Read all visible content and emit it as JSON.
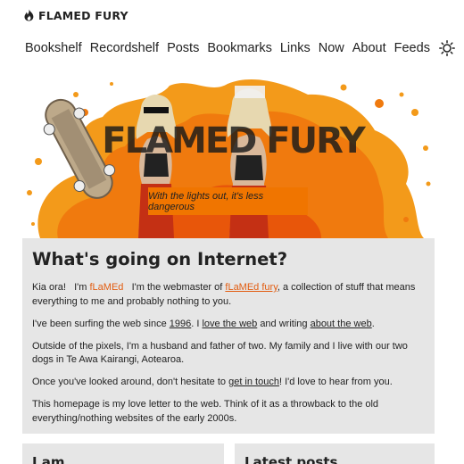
{
  "site": {
    "title": "FLAMED FURY",
    "logo_icon": "flame-icon"
  },
  "nav": {
    "items": [
      {
        "label": "Bookshelf"
      },
      {
        "label": "Recordshelf"
      },
      {
        "label": "Posts"
      },
      {
        "label": "Bookmarks"
      },
      {
        "label": "Links"
      },
      {
        "label": "Now"
      },
      {
        "label": "About"
      },
      {
        "label": "Feeds"
      }
    ],
    "theme_icon": "sun-icon"
  },
  "hero": {
    "banner_text": "FLAMED FURY",
    "tagline": "With the lights out, it's less dangerous"
  },
  "intro": {
    "title": "What's going on Internet?",
    "p1": {
      "greeting": "Kia ora!",
      "im": "I'm",
      "name": "fLaMEd",
      "middle": "I'm the webmaster of",
      "site_link": "fLaMEd fury",
      "end": ", a collection of stuff that means everything to me and probably nothing to you."
    },
    "p2": {
      "start": "I've been surfing the web since",
      "year_link": "1996",
      "mid1": ". I",
      "love_link": "love the web",
      "mid2": "and writing",
      "about_link": "about the web",
      "end": "."
    },
    "p3": "Outside of the pixels, I'm a husband and father of two. My family and I live with our two dogs in Te Awa Kairangi, Aotearoa.",
    "p4": {
      "start": "Once you've looked around, don't hesitate to",
      "contact_link": "get in touch",
      "end": "! I'd love to hear from you."
    },
    "p5": "This homepage is my love letter to the web. Think of it as a throwback to the old everything/nothing websites of the early 2000s."
  },
  "cards": {
    "left_title": "I am",
    "right_title": "Latest posts"
  },
  "colors": {
    "accent": "#e25c10",
    "panel": "#e6e6e6",
    "tagline_bg": "#f07500"
  }
}
